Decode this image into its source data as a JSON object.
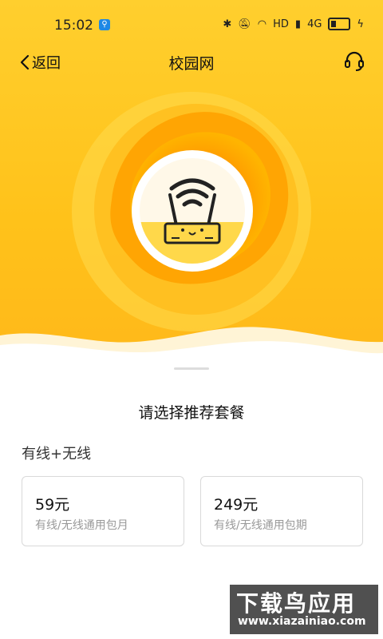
{
  "status_bar": {
    "time": "15:02",
    "network_label": "HD",
    "signal_label": "4G"
  },
  "nav": {
    "back_label": "返回",
    "title": "校园网",
    "support_icon": "headset-icon"
  },
  "hero": {
    "icon": "wifi-router-icon",
    "colors": {
      "primary": "#ffc21a",
      "accent": "#ff8a00"
    }
  },
  "sheet": {
    "title": "请选择推荐套餐",
    "group_label": "有线+无线",
    "plans": [
      {
        "price": "59元",
        "desc": "有线/无线通用包月"
      },
      {
        "price": "249元",
        "desc": "有线/无线通用包期"
      }
    ]
  },
  "watermark": {
    "title": "下载鸟应用",
    "url": "www.xiazainiao.com"
  }
}
